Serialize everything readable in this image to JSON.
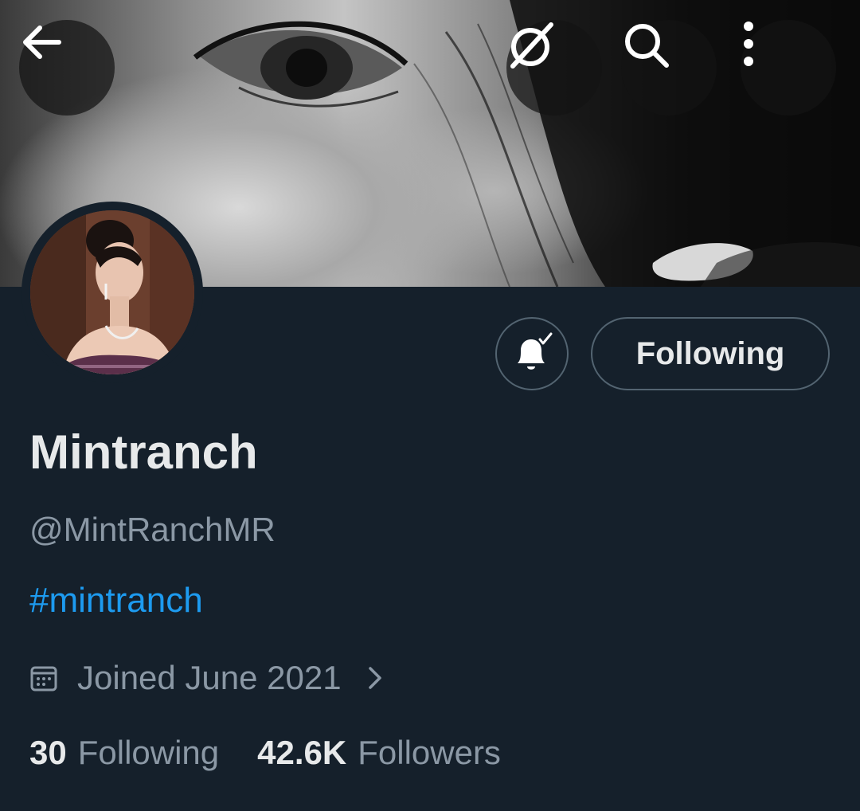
{
  "header": {
    "back_icon": "arrow-left-icon",
    "grok_icon": "grok-icon",
    "search_icon": "search-icon",
    "more_icon": "more-vertical-icon"
  },
  "profile": {
    "display_name": "Mintranch",
    "handle": "@MintRanchMR",
    "bio": "#mintranch",
    "joined": "Joined June 2021",
    "following_count": "30",
    "following_label": "Following",
    "followers_count": "42.6K",
    "followers_label": "Followers"
  },
  "actions": {
    "notify_icon": "bell-check-icon",
    "following_button_label": "Following"
  },
  "colors": {
    "background": "#15202b",
    "primary_text": "#e7e9ea",
    "secondary_text": "#8b98a5",
    "link": "#1d9bf0",
    "border": "#536471"
  }
}
